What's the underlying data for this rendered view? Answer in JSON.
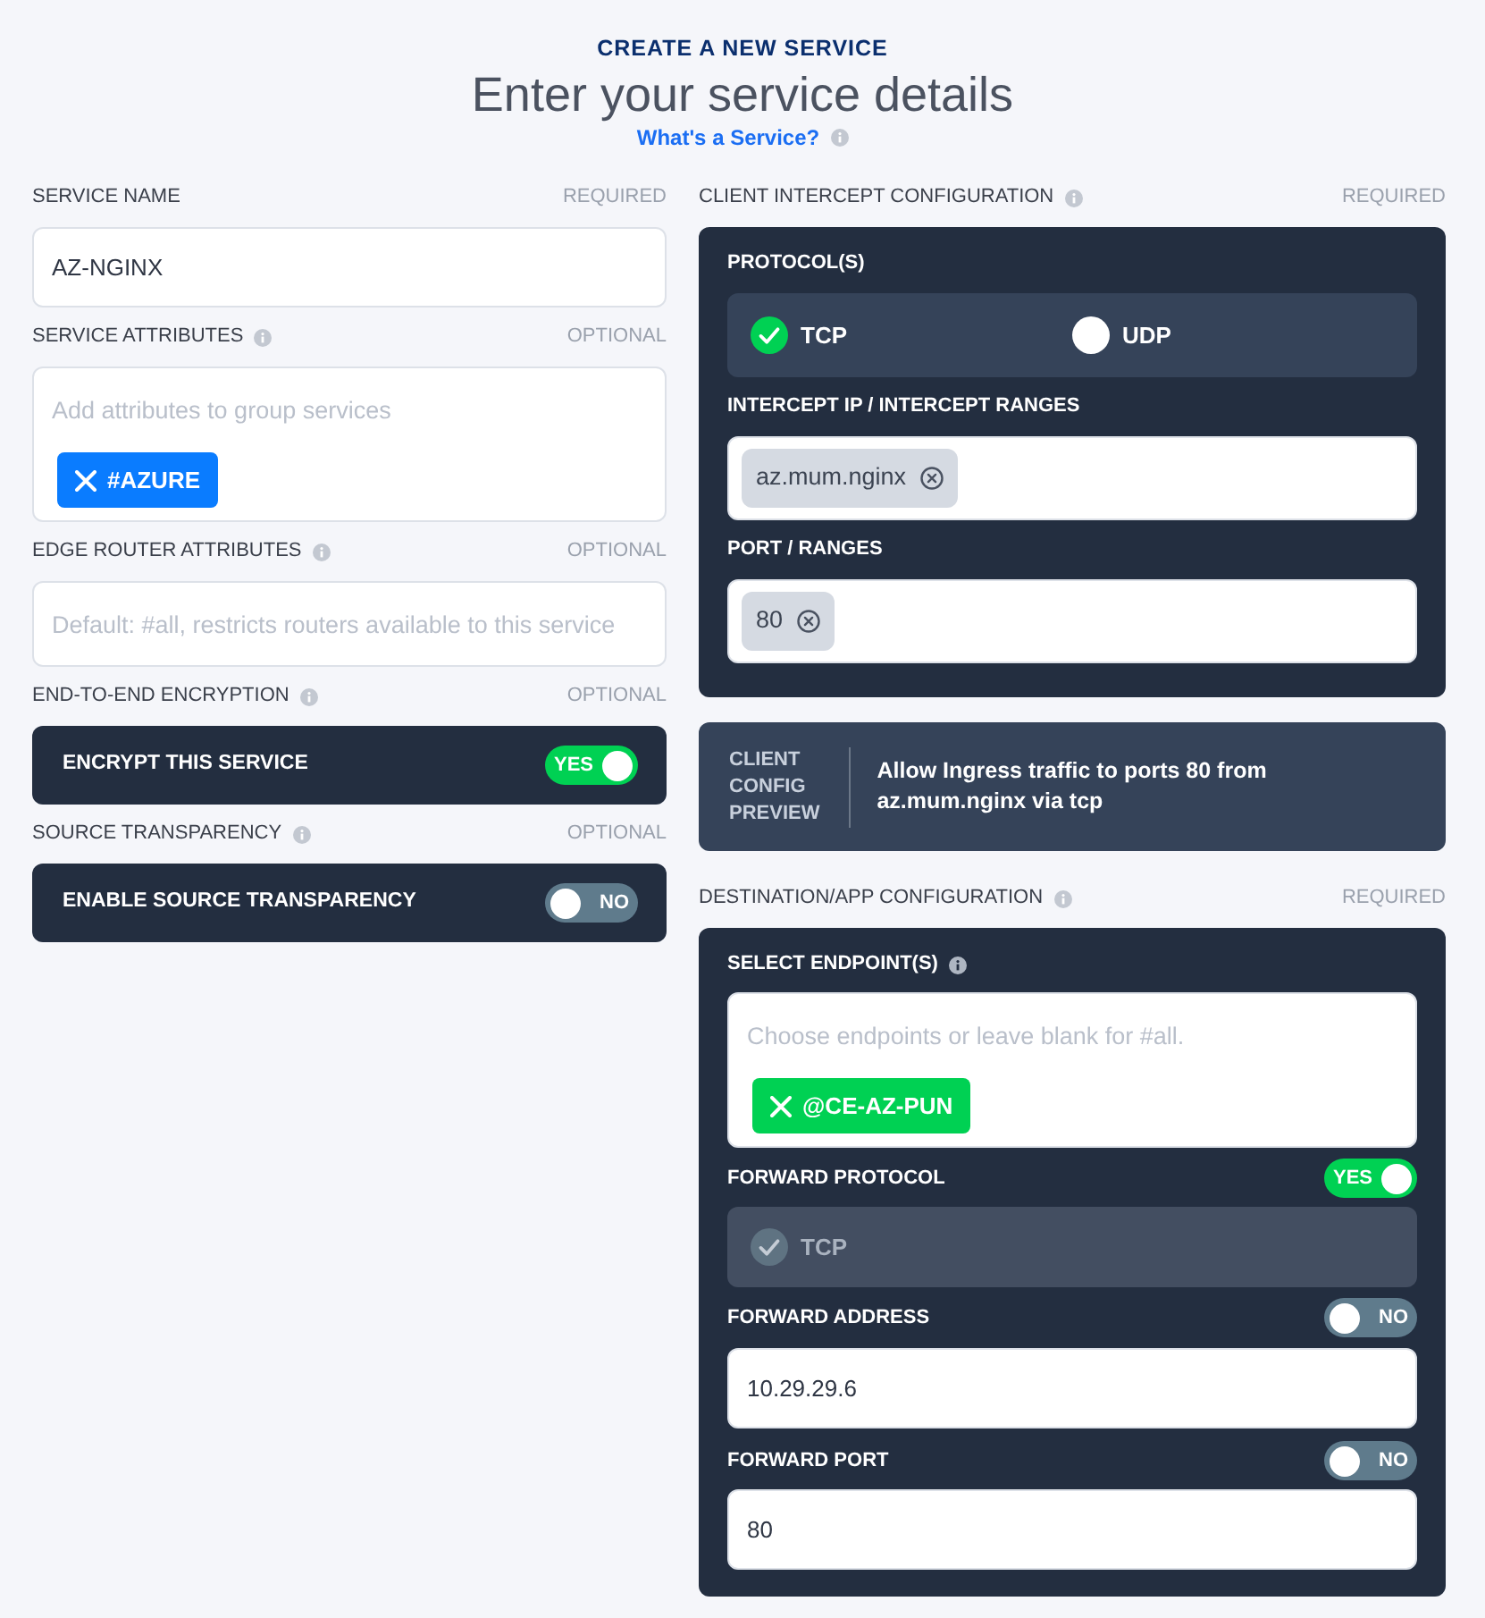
{
  "header": {
    "eyebrow": "CREATE A NEW SERVICE",
    "title": "Enter your service details",
    "help_link": "What's a Service?"
  },
  "left_column": [
    {
      "kind": "text",
      "label": "SERVICE NAME",
      "info": false,
      "requirement": "REQUIRED",
      "value": "AZ-NGINX"
    },
    {
      "kind": "tags",
      "label": "SERVICE ATTRIBUTES",
      "info": true,
      "requirement": "OPTIONAL",
      "placeholder": "Add attributes to group services",
      "tags": [
        "#AZURE"
      ]
    },
    {
      "kind": "text",
      "label": "EDGE ROUTER ATTRIBUTES",
      "info": true,
      "requirement": "OPTIONAL",
      "placeholder": "Default: #all, restricts routers available to this service"
    },
    {
      "kind": "toggle",
      "label": "END-TO-END ENCRYPTION",
      "info": true,
      "requirement": "OPTIONAL",
      "option": "ENCRYPT THIS SERVICE",
      "on": true,
      "switch_text": "YES"
    },
    {
      "kind": "toggle",
      "label": "SOURCE TRANSPARENCY",
      "info": true,
      "requirement": "OPTIONAL",
      "option": "ENABLE SOURCE TRANSPARENCY",
      "on": false,
      "switch_text": "NO"
    }
  ],
  "client_intercept": {
    "label": "CLIENT INTERCEPT CONFIGURATION",
    "info": true,
    "requirement": "REQUIRED",
    "protocols_label": "PROTOCOL(S)",
    "protocols": [
      {
        "name": "TCP",
        "checked": true
      },
      {
        "name": "UDP",
        "checked": false
      }
    ],
    "fields": [
      {
        "label": "INTERCEPT IP / INTERCEPT RANGES",
        "chips": [
          "az.mum.nginx"
        ]
      },
      {
        "label": "PORT / RANGES",
        "chips": [
          "80"
        ]
      }
    ]
  },
  "preview": {
    "heading": "CLIENT CONFIG PREVIEW",
    "text": "Allow Ingress traffic to ports 80 from az.mum.nginx via tcp"
  },
  "destination": {
    "label": "DESTINATION/APP CONFIGURATION",
    "info": true,
    "requirement": "REQUIRED",
    "endpoints": {
      "label": "SELECT ENDPOINT(S)",
      "info": true,
      "placeholder": "Choose endpoints or leave blank for #all.",
      "tags": [
        "@CE-AZ-PUN"
      ]
    },
    "forward_protocol": {
      "label": "FORWARD PROTOCOL",
      "on": true,
      "switch_text": "YES",
      "protocols": [
        {
          "name": "TCP",
          "checked": true,
          "disabled": true
        }
      ]
    },
    "forward_fields": [
      {
        "label": "FORWARD ADDRESS",
        "on": false,
        "switch_text": "NO",
        "value": "10.29.29.6"
      },
      {
        "label": "FORWARD PORT",
        "on": false,
        "switch_text": "NO",
        "value": "80"
      }
    ]
  }
}
